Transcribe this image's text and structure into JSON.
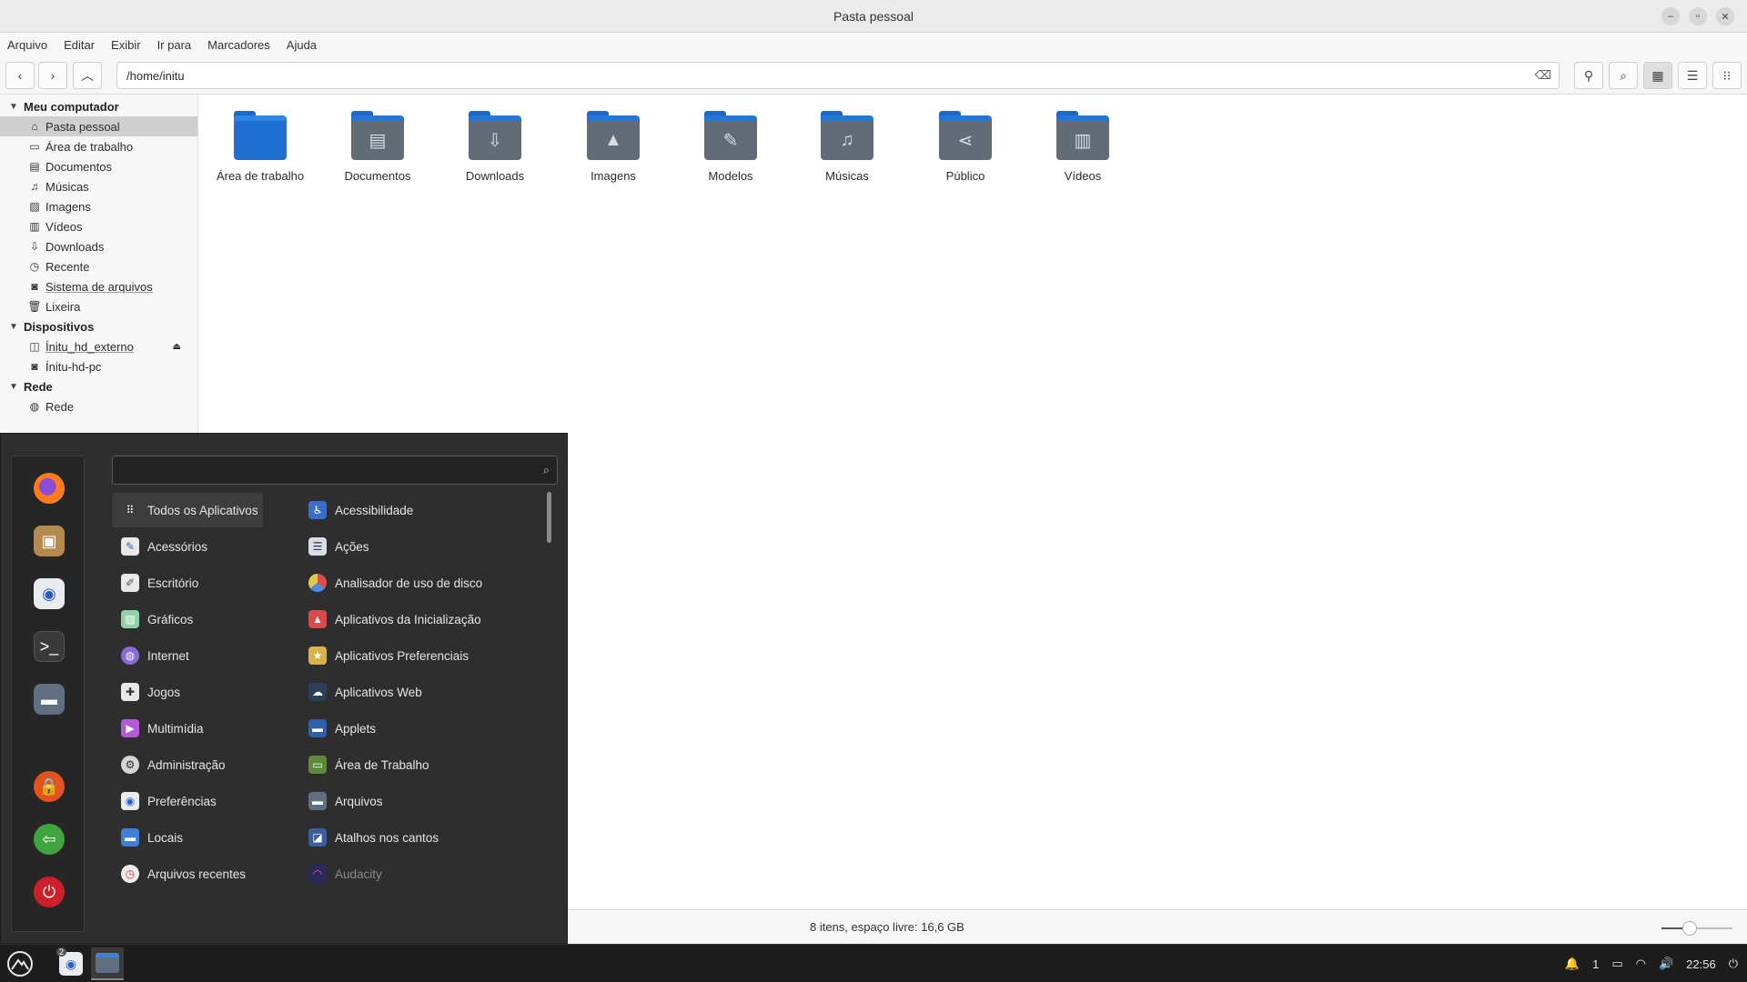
{
  "window": {
    "title": "Pasta pessoal"
  },
  "menubar": [
    "Arquivo",
    "Editar",
    "Exibir",
    "Ir para",
    "Marcadores",
    "Ajuda"
  ],
  "toolbar": {
    "path": "/home/initu"
  },
  "sidebar": {
    "sections": [
      {
        "header": "Meu computador",
        "items": [
          {
            "label": "Pasta pessoal",
            "icon": "home-icon"
          },
          {
            "label": "Área de trabalho",
            "icon": "desktop-icon"
          },
          {
            "label": "Documentos",
            "icon": "document-icon"
          },
          {
            "label": "Músicas",
            "icon": "music-icon"
          },
          {
            "label": "Imagens",
            "icon": "image-icon"
          },
          {
            "label": "Vídeos",
            "icon": "video-icon"
          },
          {
            "label": "Downloads",
            "icon": "download-icon"
          },
          {
            "label": "Recente",
            "icon": "clock-icon"
          },
          {
            "label": "Sistema de arquivos",
            "icon": "drive-icon"
          },
          {
            "label": "Lixeira",
            "icon": "trash-icon"
          }
        ]
      },
      {
        "header": "Dispositivos",
        "items": [
          {
            "label": "Ínitu_hd_externo",
            "icon": "usb-drive-icon"
          },
          {
            "label": "Ínitu-hd-pc",
            "icon": "drive-icon"
          }
        ]
      },
      {
        "header": "Rede",
        "items": [
          {
            "label": "Rede",
            "icon": "network-icon"
          }
        ]
      }
    ]
  },
  "folders": [
    {
      "label": "Área de trabalho",
      "icon": "desktop-folder-icon"
    },
    {
      "label": "Documentos",
      "icon": "documents-folder-icon"
    },
    {
      "label": "Downloads",
      "icon": "downloads-folder-icon"
    },
    {
      "label": "Imagens",
      "icon": "pictures-folder-icon"
    },
    {
      "label": "Modelos",
      "icon": "templates-folder-icon"
    },
    {
      "label": "Músicas",
      "icon": "music-folder-icon"
    },
    {
      "label": "Público",
      "icon": "public-folder-icon"
    },
    {
      "label": "Vídeos",
      "icon": "videos-folder-icon"
    }
  ],
  "status": {
    "text": "8 itens, espaço livre: 16,6 GB",
    "zoom_fraction": 0.4
  },
  "startmenu": {
    "search_value": "",
    "categories": [
      "Todos os Aplicativos",
      "Acessórios",
      "Escritório",
      "Gráficos",
      "Internet",
      "Jogos",
      "Multimídia",
      "Administração",
      "Preferências",
      "Locais",
      "Arquivos recentes"
    ],
    "apps": [
      "Acessibilidade",
      "Ações",
      "Analisador de uso de disco",
      "Aplicativos da Inicialização",
      "Aplicativos Preferenciais",
      "Aplicativos Web",
      "Applets",
      "Área de Trabalho",
      "Arquivos",
      "Atalhos nos cantos",
      "Audacity"
    ]
  },
  "taskbar": {
    "badge": "2",
    "clock": "22:56",
    "notifications": "1"
  }
}
